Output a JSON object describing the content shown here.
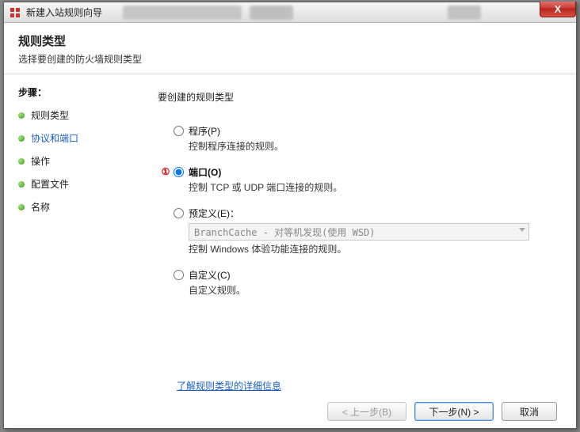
{
  "window": {
    "title": "新建入站规则向导",
    "close_glyph": "X"
  },
  "header": {
    "title": "规则类型",
    "subtitle": "选择要创建的防火墙规则类型"
  },
  "sidebar": {
    "steps_label": "步骤：",
    "items": [
      {
        "label": "规则类型",
        "active": false
      },
      {
        "label": "协议和端口",
        "active": true
      },
      {
        "label": "操作",
        "active": false
      },
      {
        "label": "配置文件",
        "active": false
      },
      {
        "label": "名称",
        "active": false
      }
    ]
  },
  "content": {
    "heading": "要创建的规则类型",
    "annotation_marker": "①",
    "options": [
      {
        "id": "program",
        "label": "程序(P)",
        "desc": "控制程序连接的规则。",
        "bold": false,
        "checked": false
      },
      {
        "id": "port",
        "label": "端口(O)",
        "desc": "控制 TCP 或 UDP 端口连接的规则。",
        "bold": true,
        "checked": true
      },
      {
        "id": "predefined",
        "label": "预定义(E)：",
        "desc": "控制 Windows 体验功能连接的规则。",
        "bold": false,
        "checked": false,
        "combo_value": "BranchCache - 对等机发现(使用 WSD)"
      },
      {
        "id": "custom",
        "label": "自定义(C)",
        "desc": "自定义规则。",
        "bold": false,
        "checked": false
      }
    ],
    "more_link": "了解规则类型的详细信息"
  },
  "buttons": {
    "back": "< 上一步(B)",
    "next": "下一步(N) >",
    "cancel": "取消"
  }
}
